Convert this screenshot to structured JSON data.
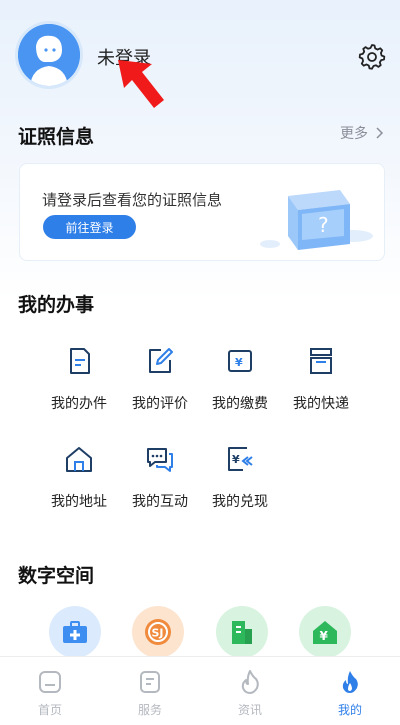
{
  "header": {
    "login_status": "未登录"
  },
  "license_section": {
    "title": "证照信息",
    "more_label": "更多",
    "prompt": "请登录后查看您的证照信息",
    "button_label": "前往登录"
  },
  "affairs_section": {
    "title": "我的办事",
    "items": [
      {
        "label": "我的办件",
        "icon": "document-icon"
      },
      {
        "label": "我的评价",
        "icon": "edit-icon"
      },
      {
        "label": "我的缴费",
        "icon": "yuan-payment-icon"
      },
      {
        "label": "我的快递",
        "icon": "parcel-icon"
      },
      {
        "label": "我的地址",
        "icon": "home-icon"
      },
      {
        "label": "我的互动",
        "icon": "chat-icon"
      },
      {
        "label": "我的兑现",
        "icon": "cash-redeem-icon"
      }
    ]
  },
  "space_section": {
    "title": "数字空间",
    "items": [
      {
        "icon": "medical-kit-icon",
        "color": "#3d8ef0"
      },
      {
        "icon": "social-security-icon",
        "color": "#f08a3d"
      },
      {
        "icon": "building-icon",
        "color": "#2eb85c"
      },
      {
        "icon": "housing-fund-icon",
        "color": "#2eb85c"
      }
    ]
  },
  "tabbar": {
    "tabs": [
      {
        "label": "首页",
        "icon": "home-tab-icon"
      },
      {
        "label": "服务",
        "icon": "service-tab-icon"
      },
      {
        "label": "资讯",
        "icon": "news-flame-icon"
      },
      {
        "label": "我的",
        "icon": "mine-flame-icon",
        "active": true
      }
    ]
  },
  "colors": {
    "accent": "#2f7fe8",
    "arrow": "#f01a1a"
  }
}
